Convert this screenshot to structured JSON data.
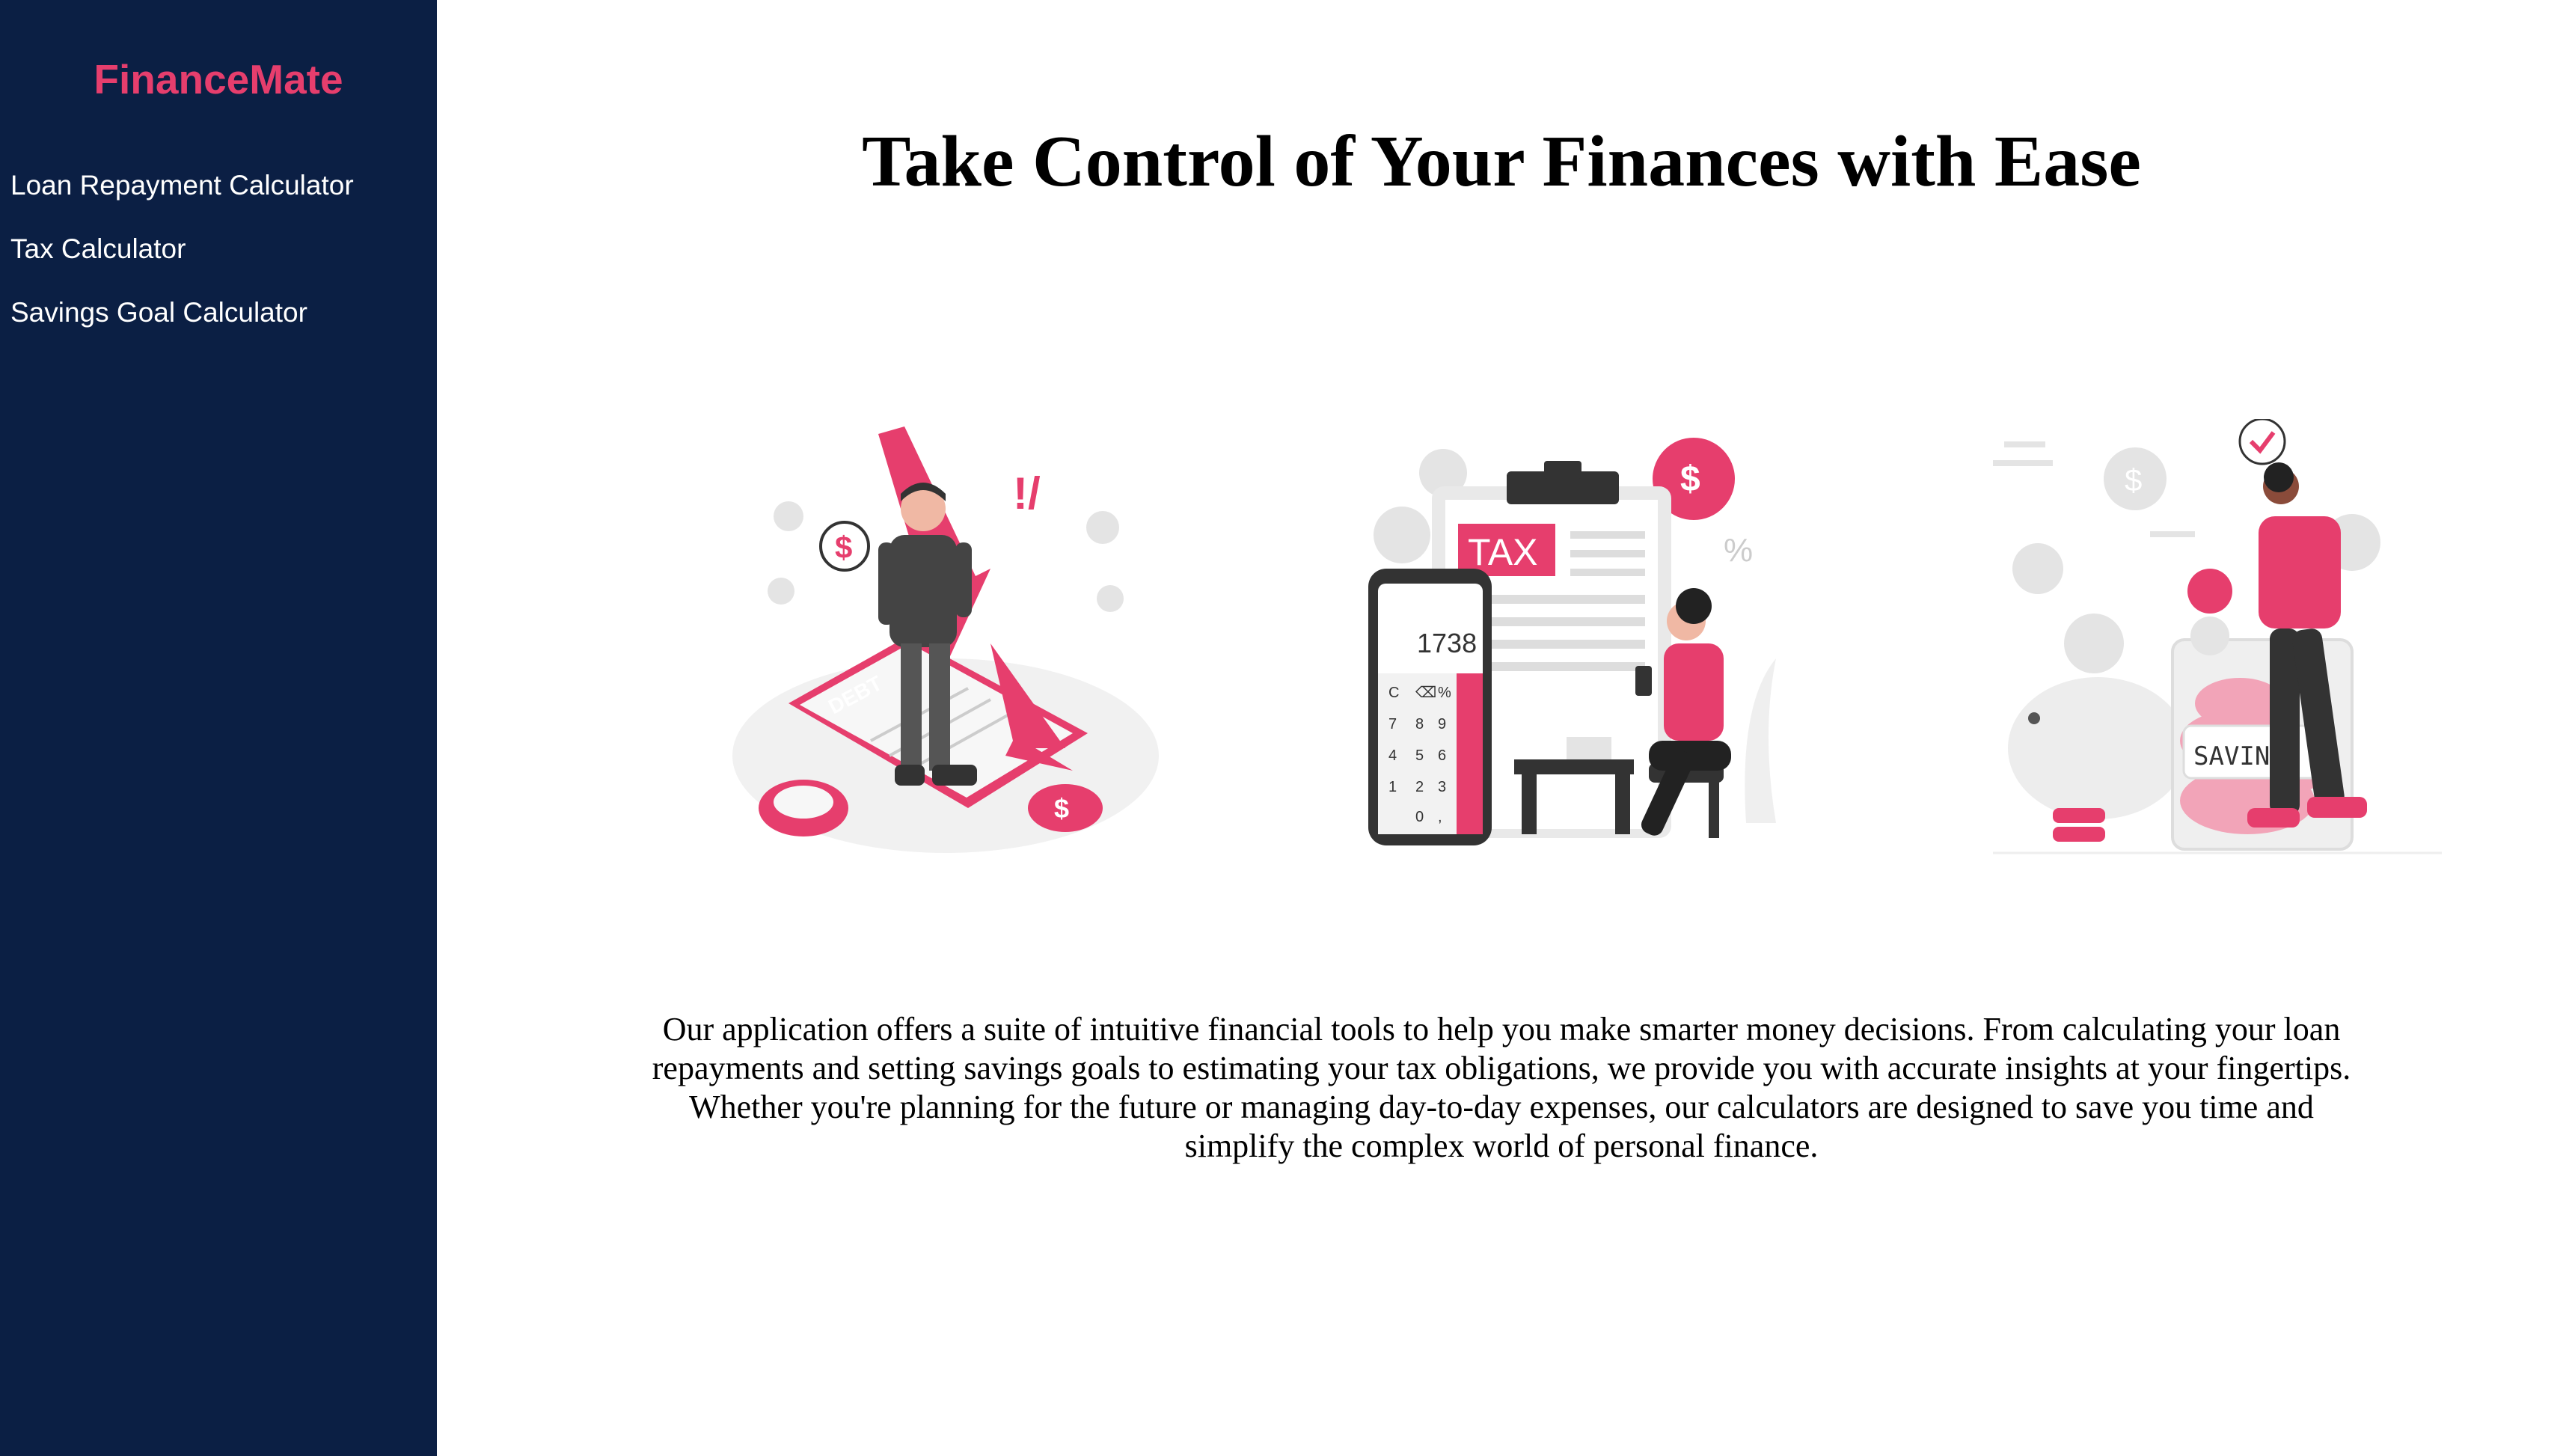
{
  "sidebar": {
    "brand": "FinanceMate",
    "items": [
      {
        "label": "Loan Repayment Calculator"
      },
      {
        "label": "Tax Calculator"
      },
      {
        "label": "Savings Goal Calculator"
      }
    ]
  },
  "main": {
    "title": "Take Control of Your Finances with Ease",
    "illustrations": {
      "debt": {
        "tag": "DEBT",
        "icon": "debt-illustration"
      },
      "tax": {
        "tag": "TAX",
        "display": "1738",
        "icon": "tax-illustration"
      },
      "savings": {
        "tag": "SAVINGS",
        "icon": "savings-illustration"
      }
    },
    "description": "Our application offers a suite of intuitive financial tools to help you make smarter money decisions. From calculating your loan repayments and setting savings goals to estimating your tax obligations, we provide you with accurate insights at your fingertips. Whether you're planning for the future or managing day-to-day expenses, our calculators are designed to save you time and simplify the complex world of personal finance."
  },
  "colors": {
    "sidebar_bg": "#0b1f44",
    "accent": "#e63e6d",
    "text": "#000000",
    "nav_text": "#ffffff"
  }
}
